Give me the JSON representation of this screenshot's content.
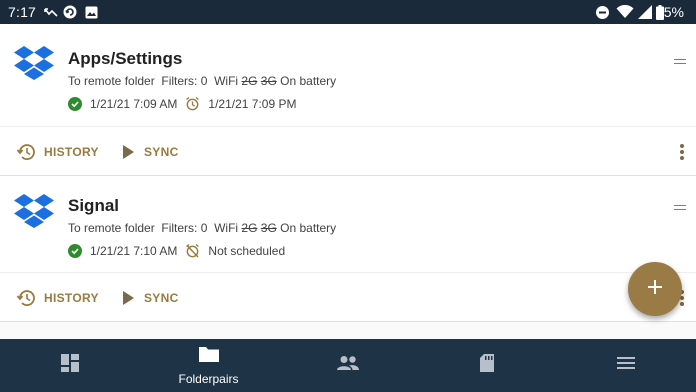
{
  "status_bar": {
    "time": "7:17",
    "battery_percent": "95%",
    "left_icons": [
      "missed-call-icon",
      "sync-circle-icon",
      "image-icon"
    ],
    "right_icons": [
      "do-not-disturb-icon",
      "wifi-icon",
      "signal-icon",
      "battery-icon"
    ]
  },
  "folderpairs": [
    {
      "title": "Apps/Settings",
      "direction": "To remote folder",
      "filters": "Filters: 0",
      "wifi": "WiFi",
      "net_2g": "2G",
      "net_3g": "3G",
      "power": "On battery",
      "last_sync": "1/21/21 7:09 AM",
      "schedule": "1/21/21 7:09 PM",
      "history_label": "HISTORY",
      "sync_label": "SYNC"
    },
    {
      "title": "Signal",
      "direction": "To remote folder",
      "filters": "Filters: 0",
      "wifi": "WiFi",
      "net_2g": "2G",
      "net_3g": "3G",
      "power": "On battery",
      "last_sync": "1/21/21 7:10 AM",
      "schedule": "Not scheduled",
      "history_label": "HISTORY",
      "sync_label": "SYNC"
    }
  ],
  "bottom_nav": {
    "items": [
      {
        "icon": "dashboard-icon",
        "label": ""
      },
      {
        "icon": "folder-icon",
        "label": "Folderpairs",
        "active": true
      },
      {
        "icon": "accounts-icon",
        "label": ""
      },
      {
        "icon": "sd-card-icon",
        "label": ""
      },
      {
        "icon": "menu-icon",
        "label": ""
      }
    ]
  },
  "colors": {
    "status_bar": "#1b2a3a",
    "bottom_nav": "#1f3347",
    "accent": "#9a7a3e",
    "fab": "#9a7a45",
    "dropbox_blue": "#1b6fe0",
    "success_green": "#2e8b2e"
  }
}
